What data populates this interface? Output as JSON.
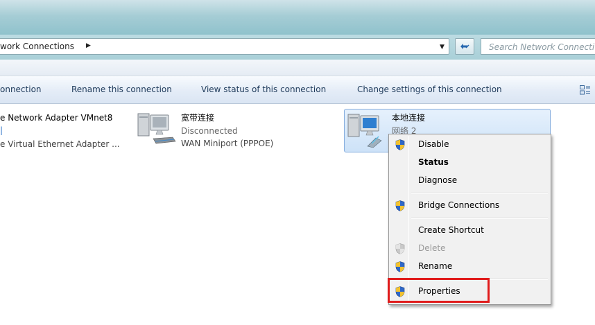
{
  "address": {
    "breadcrumb": "work Connections",
    "search_placeholder": "Search Network Connecti"
  },
  "toolbar": {
    "connect_label": "onnection",
    "rename_label": "Rename this connection",
    "view_status_label": "View status of this connection",
    "change_settings_label": "Change settings of this connection"
  },
  "items": [
    {
      "name": "e Network Adapter VMnet8",
      "status": "",
      "device": "e Virtual Ethernet Adapter ..."
    },
    {
      "name": "宽带连接",
      "status": "Disconnected",
      "device": "WAN Miniport (PPPOE)"
    },
    {
      "name": "本地连接",
      "status": "网络 2",
      "device": ""
    }
  ],
  "context_menu": {
    "items": [
      {
        "label": "Disable",
        "icon": "uac-shield-icon"
      },
      {
        "label": "Status",
        "default": true
      },
      {
        "label": "Diagnose"
      },
      {
        "label": "Bridge Connections",
        "icon": "uac-shield-icon"
      },
      {
        "label": "Create Shortcut"
      },
      {
        "label": "Delete",
        "icon": "uac-shield-icon",
        "disabled": true
      },
      {
        "label": "Rename",
        "icon": "uac-shield-icon"
      },
      {
        "label": "Properties",
        "icon": "uac-shield-icon"
      }
    ]
  },
  "colors": {
    "highlight_border": "#e01b1b",
    "selection_border": "#84acdd",
    "titlebar": "#a6cdd5"
  }
}
